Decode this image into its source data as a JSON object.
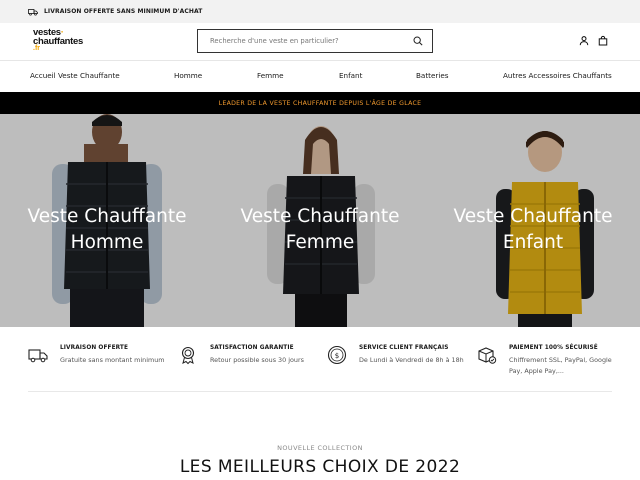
{
  "announcement": {
    "text": "LIVRAISON OFFERTE SANS MINIMUM D'ACHAT",
    "icon": "truck-icon"
  },
  "header": {
    "logo": {
      "line1": "vestes",
      "line2": "chauffantes",
      "line3": ".fr",
      "accent": "#f2a500"
    },
    "search": {
      "placeholder": "Recherche d'une veste en particulier?",
      "icon": "search-icon"
    },
    "icons": [
      "account-icon",
      "cart-icon"
    ]
  },
  "nav": {
    "items": [
      {
        "label": "Accueil Veste Chauffante"
      },
      {
        "label": "Homme"
      },
      {
        "label": "Femme"
      },
      {
        "label": "Enfant"
      },
      {
        "label": "Batteries"
      },
      {
        "label": "Autres Accessoires Chauffants"
      }
    ]
  },
  "promo": {
    "text": "LEADER DE LA VESTE CHAUFFANTE DEPUIS L'ÂGE DE GLACE",
    "color": "#f29a2e",
    "background": "#000000"
  },
  "hero": {
    "panels": [
      {
        "line1": "Veste Chauffante",
        "line2": "Homme"
      },
      {
        "line1": "Veste Chauffante",
        "line2": "Femme"
      },
      {
        "line1": "Veste Chauffante",
        "line2": "Enfant"
      }
    ]
  },
  "features": [
    {
      "icon": "delivery-truck-icon",
      "title": "LIVRAISON OFFERTE",
      "desc": "Gratuite sans montant minimum"
    },
    {
      "icon": "award-badge-icon",
      "title": "SATISFACTION GARANTIE",
      "desc": "Retour possible sous 30 jours"
    },
    {
      "icon": "dollar-coin-icon",
      "title": "SERVICE CLIENT FRANÇAIS",
      "desc": "De Lundi à Vendredi de 8h à 18h"
    },
    {
      "icon": "secure-package-icon",
      "title": "PAIEMENT 100% SÉCURISÉ",
      "desc": "Chiffrement SSL, PayPal, Google Pay, Apple Pay,..."
    }
  ],
  "collection": {
    "subtitle": "NOUVELLE COLLECTION",
    "title": "LES MEILLEURS CHOIX DE 2022"
  }
}
